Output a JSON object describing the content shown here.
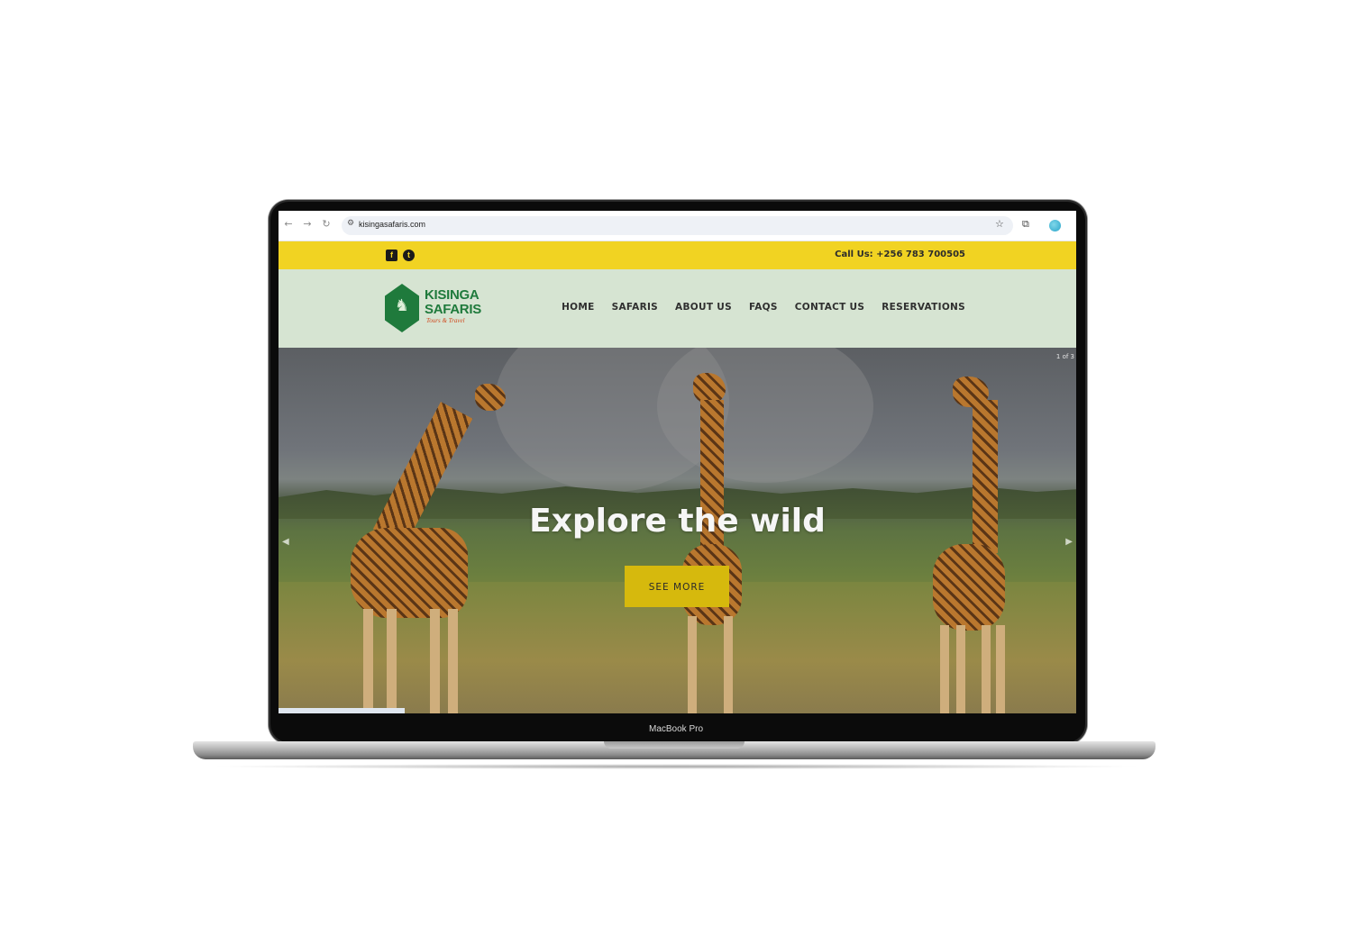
{
  "device": {
    "label": "MacBook Pro"
  },
  "browser": {
    "url": "kisingasafaris.com",
    "icons": [
      "back-arrow-icon",
      "forward-arrow-icon",
      "reload-icon",
      "site-settings-icon",
      "bookmark-star-icon",
      "extensions-icon",
      "profile-avatar-icon"
    ]
  },
  "topbar": {
    "social": [
      "facebook-icon",
      "twitter-icon"
    ],
    "call": "Call Us: +256 783 700505"
  },
  "logo": {
    "line1": "KISINGA",
    "line2": "SAFARIS",
    "tagline": "Tours & Travel"
  },
  "nav": {
    "items": [
      "HOME",
      "SAFARIS",
      "ABOUT US",
      "FAQS",
      "CONTACT US",
      "RESERVATIONS"
    ]
  },
  "hero": {
    "title": "Explore the wild",
    "button": "SEE MORE",
    "counter": "1 of 3"
  },
  "colors": {
    "topbar": "#f1d322",
    "header": "#d6e4d2",
    "brand_green": "#1f7a3c",
    "button": "#d6b90d"
  }
}
